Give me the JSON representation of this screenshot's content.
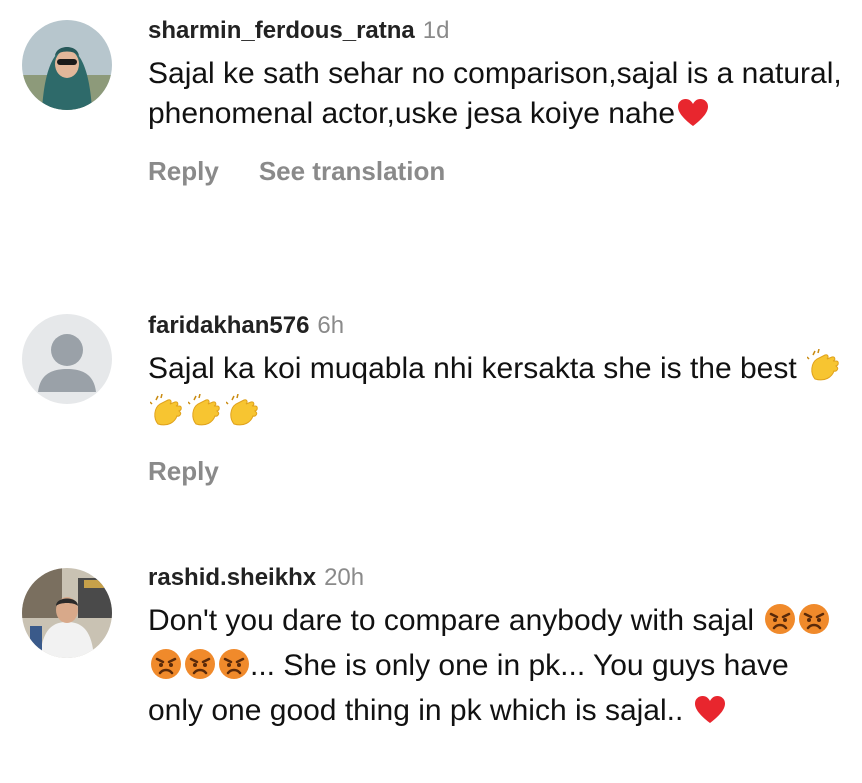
{
  "comments": [
    {
      "username": "sharmin_ferdous_ratna",
      "time": "1d",
      "text": "Sajal ke sath sehar  no comparison,sajal is a natural, phenomenal actor,uske jesa koiye nahe",
      "emoji": [
        "red-heart"
      ],
      "actions": {
        "reply": "Reply",
        "translate": "See translation"
      }
    },
    {
      "username": "faridakhan576",
      "time": "6h",
      "text": "Sajal ka koi muqabla nhi kersakta she is the best",
      "emoji": [
        "clapping-hands",
        "clapping-hands",
        "clapping-hands",
        "clapping-hands"
      ],
      "actions": {
        "reply": "Reply"
      }
    },
    {
      "username": "rashid.sheikhx",
      "time": "20h",
      "text_part1": "Don't you dare to compare anybody with sajal",
      "emoji_mid": [
        "angry-face",
        "angry-face",
        "angry-face",
        "angry-face",
        "angry-face"
      ],
      "text_part2": "... She is only one in pk... You guys have only one good thing in pk which is sajal..",
      "emoji_end": [
        "red-heart"
      ]
    }
  ],
  "colors": {
    "text": "#111111",
    "meta_gray": "#8a8a8a",
    "heart": "#e8262e",
    "clap": "#f7c531",
    "angry": "#f08a2b"
  }
}
